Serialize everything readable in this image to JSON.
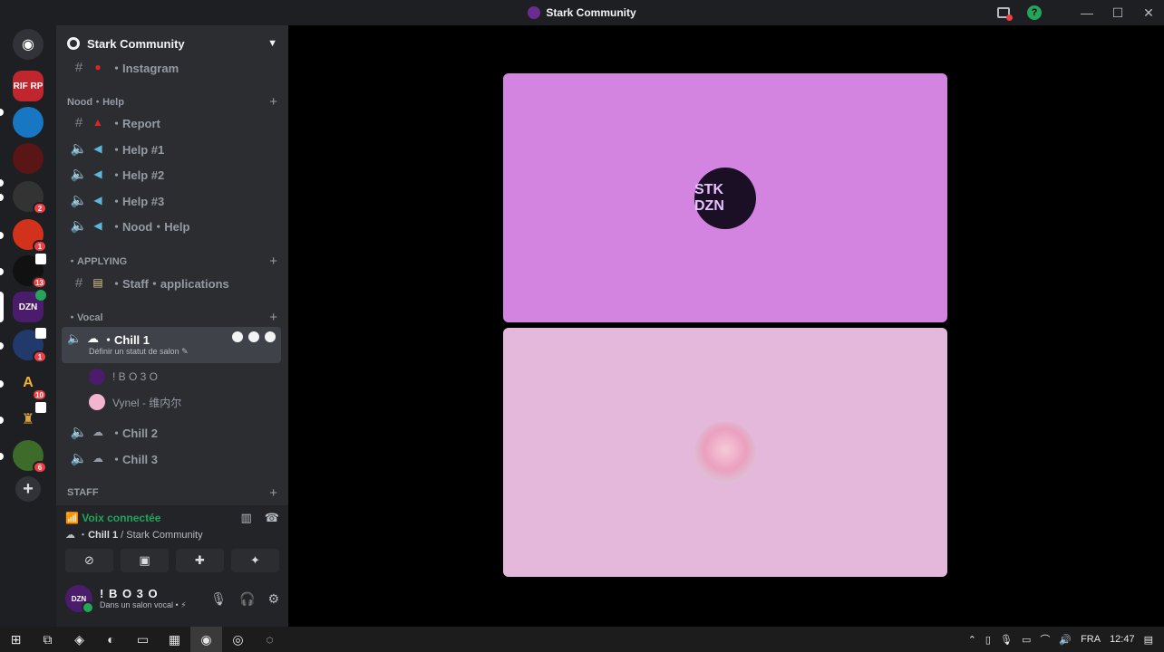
{
  "window": {
    "title": "Stark Community"
  },
  "colors": {
    "accent": "#5865f2",
    "online": "#23a55a",
    "danger": "#f23f43",
    "tile1": "#d383e0",
    "tile2": "#e4b8da"
  },
  "guilds": [
    {
      "label": "RIF RP",
      "badge": ""
    },
    {
      "label": "",
      "badge": ""
    },
    {
      "label": "",
      "badge": ""
    },
    {
      "label": "",
      "badge": "2"
    },
    {
      "label": "",
      "badge": "1"
    },
    {
      "label": "",
      "badge": "13"
    },
    {
      "label": "DZN",
      "badge": ""
    },
    {
      "label": "",
      "badge": "1"
    },
    {
      "label": "",
      "badge": "10"
    },
    {
      "label": "",
      "badge": ""
    },
    {
      "label": "",
      "badge": "6"
    }
  ],
  "server": {
    "name": "Stark Community"
  },
  "channels": {
    "instagram": "・Instagram",
    "cat_help": "Nood・Help",
    "report": "・Report",
    "help1": "・Help #1",
    "help2": "・Help #2",
    "help3": "・Help #3",
    "nood_help": "・Nood・Help",
    "cat_applying": "・APPLYING",
    "staff_apps": "・Staff・applications",
    "cat_vocal": "・Vocal",
    "chill1": "・Chill 1",
    "chill1_status": "Définir un statut de salon",
    "chill2": "・Chill 2",
    "chill3": "・Chill 3",
    "cat_staff": "STAFF"
  },
  "members": [
    {
      "name": "! B O 3 O"
    },
    {
      "name": "Vynel - 维内尔"
    }
  ],
  "voice": {
    "status": "Voix connectée",
    "channel": "Chill 1",
    "server": "/ Stark Community"
  },
  "user": {
    "name": "! B O 3 O",
    "state": "Dans un salon vocal •"
  },
  "tiles": [
    {
      "avatar_text": "STK DZN"
    },
    {
      "avatar_text": ""
    }
  ],
  "taskbar": {
    "lang": "FRA",
    "time": "12:47"
  }
}
